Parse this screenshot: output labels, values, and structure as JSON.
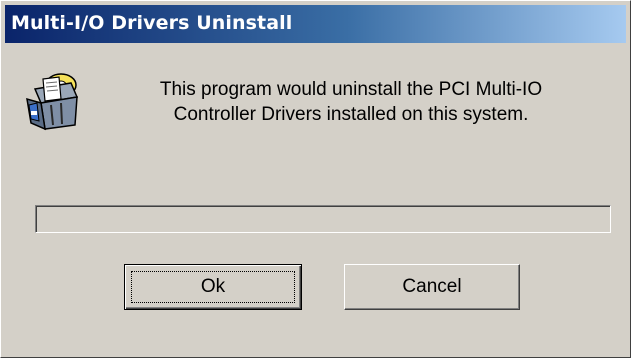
{
  "window": {
    "title": "Multi-I/O Drivers Uninstall"
  },
  "icon": "setup-uninstall-icon",
  "message": {
    "line1": "This program would uninstall the PCI Multi-IO",
    "line2": "Controller Drivers installed on this system."
  },
  "progress": {
    "fraction": 0.0
  },
  "buttons": {
    "ok_label": "Ok",
    "cancel_label": "Cancel"
  },
  "colors": {
    "titlebar_start": "#0a246a",
    "titlebar_end": "#a6caf0",
    "dialog_face": "#d4d0c8"
  }
}
